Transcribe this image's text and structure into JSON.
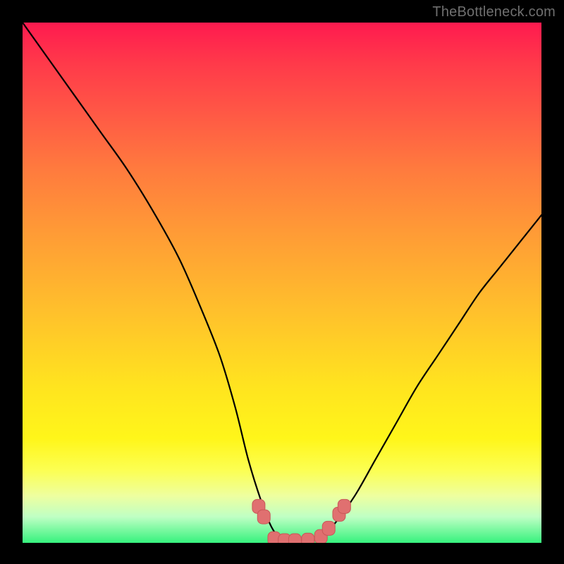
{
  "watermark": "TheBottleneck.com",
  "chart_data": {
    "type": "line",
    "title": "",
    "xlabel": "",
    "ylabel": "",
    "xlim": [
      0,
      100
    ],
    "ylim": [
      0,
      100
    ],
    "series": [
      {
        "name": "curve",
        "x": [
          0,
          5,
          10,
          15,
          20,
          25,
          30,
          34,
          38,
          41,
          43.5,
          46,
          48,
          50,
          52,
          54,
          56,
          58,
          60,
          64,
          68,
          72,
          76,
          80,
          84,
          88,
          92,
          96,
          100
        ],
        "y": [
          100,
          93,
          86,
          79,
          72,
          64,
          55,
          46,
          36,
          26,
          16,
          8,
          3,
          0.5,
          0,
          0,
          0.5,
          1.5,
          3.5,
          9,
          16,
          23,
          30,
          36,
          42,
          48,
          53,
          58,
          63
        ]
      }
    ],
    "markers": [
      {
        "x": 45.5,
        "y": 7
      },
      {
        "x": 46.5,
        "y": 5
      },
      {
        "x": 48.5,
        "y": 0.8
      },
      {
        "x": 50.5,
        "y": 0.4
      },
      {
        "x": 52.5,
        "y": 0.4
      },
      {
        "x": 55,
        "y": 0.5
      },
      {
        "x": 57.5,
        "y": 1.2
      },
      {
        "x": 59,
        "y": 2.8
      },
      {
        "x": 61,
        "y": 5.5
      },
      {
        "x": 62,
        "y": 7
      }
    ],
    "colors": {
      "curve": "#000000",
      "marker_fill": "#e07070",
      "marker_stroke": "#c85858"
    }
  }
}
